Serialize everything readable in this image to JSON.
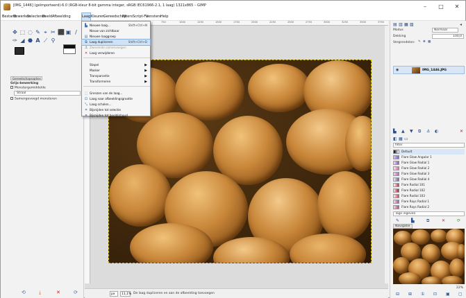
{
  "window": {
    "title": "[IMG_1446] (geïmporteerd)-6.0 (RGB-kleur 8-bit gamma integer, sRGB IEC61966-2.1, 1 laag) 1321x865 – GIMP",
    "minimize": "–",
    "maximize": "□",
    "close": "✕"
  },
  "menubar": [
    "Bestand",
    "Bewerken",
    "Selecteren",
    "Beeld",
    "Afbeelding",
    "Laag",
    "Kleuren",
    "Gereedschap",
    "Filters",
    "Script-Fu",
    "Vensters",
    "Help"
  ],
  "menubar_active": "Laag",
  "layer_menu": {
    "items": [
      {
        "label": "Nieuwe laag...",
        "shortcut": "Shift+Ctrl+N",
        "icon": "new-layer-icon"
      },
      {
        "label": "Nieuw van zichtbaar",
        "shortcut": "",
        "icon": ""
      },
      {
        "label": "Nieuwe laaggroep",
        "shortcut": "",
        "icon": "layer-group-icon"
      },
      {
        "label": "Laag dupliceren",
        "shortcut": "Shift+Ctrl+D",
        "icon": "duplicate-icon",
        "highlight": true
      },
      {
        "label": "Zwevende samenvoegen",
        "shortcut": "",
        "icon": "anchor-icon",
        "disabled": true
      },
      {
        "label": "Laag verwijderen",
        "shortcut": "",
        "icon": "delete-icon"
      }
    ],
    "submenus": [
      "Stapel",
      "Masker",
      "Transparantie",
      "Transformeren"
    ],
    "bottom_items": [
      {
        "label": "Grenzen van de laag...",
        "icon": "layer-size-icon"
      },
      {
        "label": "Laag naar afbeeldingsgrootte",
        "icon": "fit-icon"
      },
      {
        "label": "Laag schalen...",
        "icon": "scale-icon"
      },
      {
        "label": "Bijsnijden tot selectie",
        "icon": "crop-icon"
      },
      {
        "label": "Bijsnijden tot beeldinhoud",
        "icon": "crop-content-icon"
      }
    ],
    "submenu_arrow": "▶"
  },
  "toolbox": {
    "tab_label": "Gereedschapsopties",
    "opts_title": "Grijs-bewerking",
    "option_1": "Monstergemiddelde",
    "select_value": "Straal",
    "option_2": "Samengevoegd monsteren",
    "tools": [
      "✥",
      "⬚",
      "◌",
      "✎",
      "⌖",
      "✂",
      "⬛",
      "▣",
      "/",
      "✑",
      "◢",
      "⬣",
      "A",
      "⟋",
      "⚲"
    ],
    "bottom_icons": [
      "⟲",
      "⤓",
      "✕",
      "⟳"
    ]
  },
  "ruler": {
    "labels": [
      "0",
      "250",
      "500",
      "750",
      "1000",
      "1250",
      "1500",
      "1750",
      "2000",
      "2250",
      "2500",
      "2750",
      "3000",
      "3250",
      "3500",
      "3750"
    ]
  },
  "statusbar": {
    "unit": "px",
    "zoom": "11,1%",
    "message": "De laag dupliceren en aan de afbeelding toevoegen"
  },
  "dock": {
    "mode_label": "Modus",
    "mode_value": "Normaal",
    "opacity_label": "Dekking",
    "opacity_value": "100,0",
    "lock_label": "Vergrendelen:",
    "layer_name": "IMG_1446.JPG",
    "filter_label": "filter",
    "gradients": [
      {
        "name": "Default",
        "c1": "#000000",
        "c2": "#ffffff",
        "selected": true
      },
      {
        "name": "Flare Glow Angular 1",
        "c1": "#e8c0d8",
        "c2": "#6a6ad0"
      },
      {
        "name": "Flare Glow Radial 1",
        "c1": "#f0e0f0",
        "c2": "#8a5ab0"
      },
      {
        "name": "Flare Glow Radial 2",
        "c1": "#ffe4f0",
        "c2": "#d06aa0"
      },
      {
        "name": "Flare Glow Radial 3",
        "c1": "#f4d0f0",
        "c2": "#a070c0"
      },
      {
        "name": "Flare Glow Radial 4",
        "c1": "#f0f0ff",
        "c2": "#7060a0"
      },
      {
        "name": "Flare Radial 101",
        "c1": "#ffffff",
        "c2": "#c03050"
      },
      {
        "name": "Flare Radial 102",
        "c1": "#ffe0e0",
        "c2": "#a02040"
      },
      {
        "name": "Flare Radial 103",
        "c1": "#fff0f0",
        "c2": "#d04060"
      },
      {
        "name": "Flare Rays Radial 1",
        "c1": "#f8e0ec",
        "c2": "#9060a0"
      },
      {
        "name": "Flare Rays Radial 2",
        "c1": "#f0d8e8",
        "c2": "#b05080"
      }
    ],
    "tags_label": "Tags ingeven",
    "navigator_tab": "Navigatie",
    "nav_zoom": "22%"
  }
}
